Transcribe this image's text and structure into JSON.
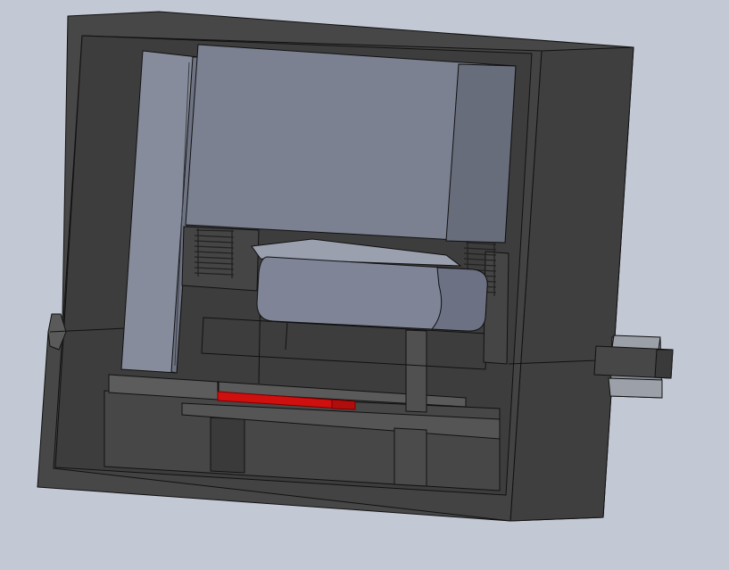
{
  "view": {
    "type": "cad-section-view",
    "background_color": "#c3c9d4",
    "edge_color": "#111111"
  },
  "parts": {
    "housing": {
      "color": "#4a4a4a",
      "face_color": "#3b3b3b"
    },
    "main_block": {
      "color": "#7b8191",
      "side_color": "#686d7c"
    },
    "vertical_plate": {
      "color": "#868c9b"
    },
    "roller": {
      "color": "#7f8597"
    },
    "springs": {
      "color": "#6a6a6a"
    },
    "red_strip": {
      "color": "#d00f0f"
    },
    "side_connector": {
      "color": "#8a8e96"
    }
  }
}
